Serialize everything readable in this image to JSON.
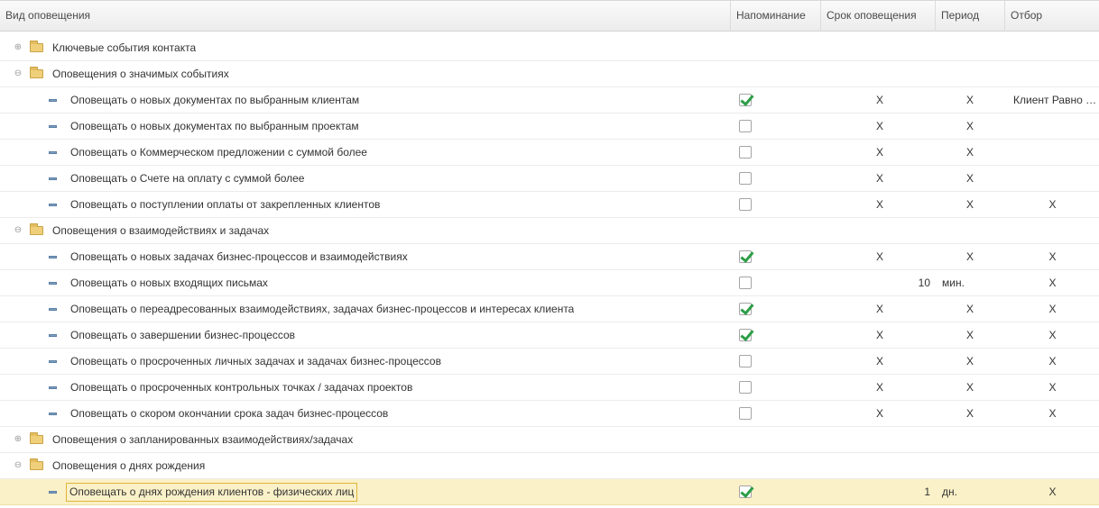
{
  "columns": {
    "type": "Вид оповещения",
    "reminder": "Напоминание",
    "term": "Срок оповещения",
    "period": "Период",
    "filter": "Отбор"
  },
  "expander_symbols": {
    "collapsed": "⊕",
    "expanded": "⊖"
  },
  "icons": {
    "group": "folder-icon",
    "item": "notification-item-icon"
  },
  "colors": {
    "selected_row": "#fbf1c8",
    "check": "#2c9e47",
    "folder": "#efcf7a"
  },
  "rows": [
    {
      "kind": "group",
      "expanded": false,
      "title": "Ключевые события контакта"
    },
    {
      "kind": "group",
      "expanded": true,
      "title": "Оповещения о значимых событиях"
    },
    {
      "kind": "item",
      "title": "Оповещать о новых документах по выбранным клиентам",
      "checked": true,
      "term": "X",
      "period": "X",
      "filter": "Клиент Равно \"Вектор\""
    },
    {
      "kind": "item",
      "title": "Оповещать о новых документах по выбранным проектам",
      "checked": false,
      "term": "X",
      "period": "X",
      "filter": ""
    },
    {
      "kind": "item",
      "title": "Оповещать о Коммерческом предложении с суммой более",
      "checked": false,
      "term": "X",
      "period": "X",
      "filter": ""
    },
    {
      "kind": "item",
      "title": "Оповещать о Счете на оплату с суммой более",
      "checked": false,
      "term": "X",
      "period": "X",
      "filter": ""
    },
    {
      "kind": "item",
      "title": "Оповещать о поступлении оплаты от закрепленных клиентов",
      "checked": false,
      "term": "X",
      "period": "X",
      "filter": "X"
    },
    {
      "kind": "group",
      "expanded": true,
      "title": "Оповещения о взаимодействиях и задачах"
    },
    {
      "kind": "item",
      "title": "Оповещать о новых задачах бизнес-процессов и взаимодействиях",
      "checked": true,
      "term": "X",
      "period": "X",
      "filter": "X"
    },
    {
      "kind": "item",
      "title": "Оповещать о новых входящих письмах",
      "checked": false,
      "term": "10",
      "period": "мин.",
      "filter": "X"
    },
    {
      "kind": "item",
      "title": "Оповещать о переадресованных взаимодействиях, задачах бизнес-процессов и интересах клиента",
      "checked": true,
      "term": "X",
      "period": "X",
      "filter": "X"
    },
    {
      "kind": "item",
      "title": "Оповещать о завершении бизнес-процессов",
      "checked": true,
      "term": "X",
      "period": "X",
      "filter": "X"
    },
    {
      "kind": "item",
      "title": "Оповещать о просроченных личных задачах и задачах бизнес-процессов",
      "checked": false,
      "term": "X",
      "period": "X",
      "filter": "X"
    },
    {
      "kind": "item",
      "title": "Оповещать о просроченных контрольных точках / задачах проектов",
      "checked": false,
      "term": "X",
      "period": "X",
      "filter": "X"
    },
    {
      "kind": "item",
      "title": "Оповещать о скором окончании срока задач бизнес-процессов",
      "checked": false,
      "term": "X",
      "period": "X",
      "filter": "X"
    },
    {
      "kind": "group",
      "expanded": false,
      "title": "Оповещения о запланированных взаимодействиях/задачах"
    },
    {
      "kind": "group",
      "expanded": true,
      "title": "Оповещения о днях рождения"
    },
    {
      "kind": "item",
      "title": "Оповещать о днях рождения клиентов - физических лиц",
      "checked": true,
      "term": "1",
      "period": "дн.",
      "filter": "X",
      "selected": true
    }
  ]
}
